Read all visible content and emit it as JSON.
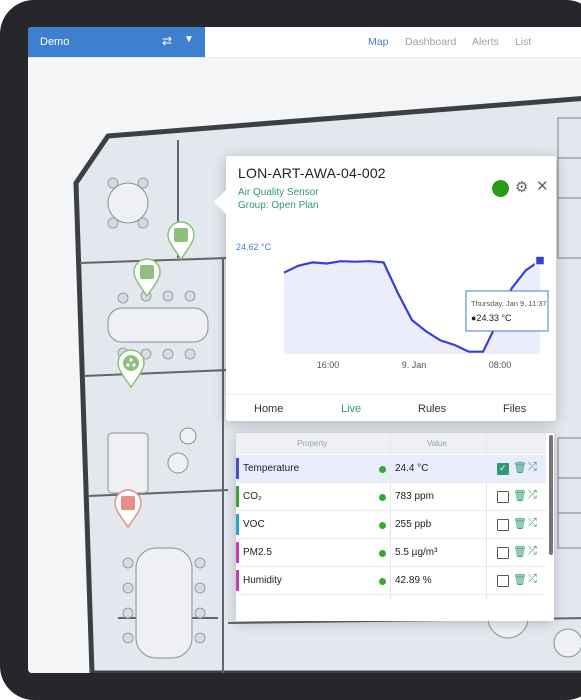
{
  "topbar": {
    "selector_label": "Demo",
    "nav": [
      "Map",
      "Dashboard",
      "Alerts",
      "List"
    ],
    "active_nav": "Map"
  },
  "popup": {
    "title": "LON-ART-AWA-04-002",
    "sensor_type": "Air Quality Sensor",
    "group": "Group: Open Plan",
    "chart_data": {
      "type": "line",
      "y_label_top": "24.62 °C",
      "x_ticks": [
        "16:00",
        "9. Jan",
        "08:00"
      ],
      "tooltip_date": "Thursday, Jan 9, 11:37",
      "tooltip_value": "●24.33 °C",
      "series": [
        {
          "values": [
            23.8,
            24.1,
            24.25,
            24.2,
            24.3,
            24.28,
            24.3,
            24.25,
            22.9,
            21.7,
            21.2,
            20.8,
            20.6,
            20.3,
            20.3,
            21.6,
            23.1,
            23.9,
            24.33
          ]
        }
      ]
    },
    "tabs": [
      "Home",
      "Live",
      "Rules",
      "Files"
    ],
    "active_tab": "Live"
  },
  "table": {
    "headers": [
      "Property",
      "Value"
    ],
    "rows": [
      {
        "name": "Temperature",
        "value": "24.4 °C",
        "color": "#4a4fc9",
        "selected": true
      },
      {
        "name": "CO₂",
        "value": "783 ppm",
        "color": "#35a833",
        "selected": false
      },
      {
        "name": "VOC",
        "value": "255 ppb",
        "color": "#2aa3c8",
        "selected": false
      },
      {
        "name": "PM2.5",
        "value": "5.5 µg/m³",
        "color": "#c93ab5",
        "selected": false
      },
      {
        "name": "Humidity",
        "value": "42.89 %",
        "color": "#c93ab5",
        "selected": false
      }
    ]
  },
  "colors": {
    "accent": "#3f7fcf",
    "green": "#2f9a74",
    "status": "#2a9a1b"
  }
}
